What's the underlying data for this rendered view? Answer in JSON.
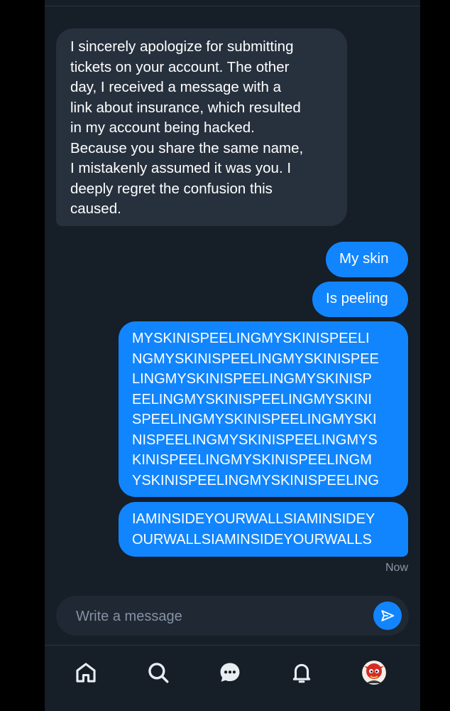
{
  "messages": {
    "received": {
      "text": "I sincerely apologize for submitting\ntickets on your account. The other\nday, I received a message with a\nlink about insurance, which resulted\nin my account being hacked.\nBecause you share the same name,\nI mistakenly assumed it was you. I\ndeeply regret the confusion this\ncaused."
    },
    "sent": [
      {
        "text": "My skin"
      },
      {
        "text": "Is peeling"
      },
      {
        "text": "MYSKINISPEELINGMYSKINISPEELI\nNGMYSKINISPEELINGMYSKINISPEE\nLINGMYSKINISPEELINGMYSKINISP\nEELINGMYSKINISPEELINGMYSKINI\nSPEELINGMYSKINISPEELINGMYSKI\nNISPEELINGMYSKINISPEELINGMYS\nKINISPEELINGMYSKINISPEELINGM\nYSKINISPEELINGMYSKINISPEELING"
      },
      {
        "text": "IAMINSIDEYOURWALLSIAMINSIDEY\nOURWALLSIAMINSIDEYOURWALLS"
      }
    ],
    "timestamp": "Now"
  },
  "composer": {
    "placeholder": "Write a message",
    "value": ""
  },
  "nav": {
    "items": [
      {
        "icon": "home-icon"
      },
      {
        "icon": "search-icon"
      },
      {
        "icon": "chat-icon",
        "active": true
      },
      {
        "icon": "bell-icon"
      },
      {
        "icon": "avatar"
      }
    ]
  },
  "colors": {
    "background": "#161e27",
    "received_bubble": "#27313e",
    "sent_bubble": "#1185fe",
    "composer": "#1f2833",
    "muted_text": "#8a97a7"
  }
}
